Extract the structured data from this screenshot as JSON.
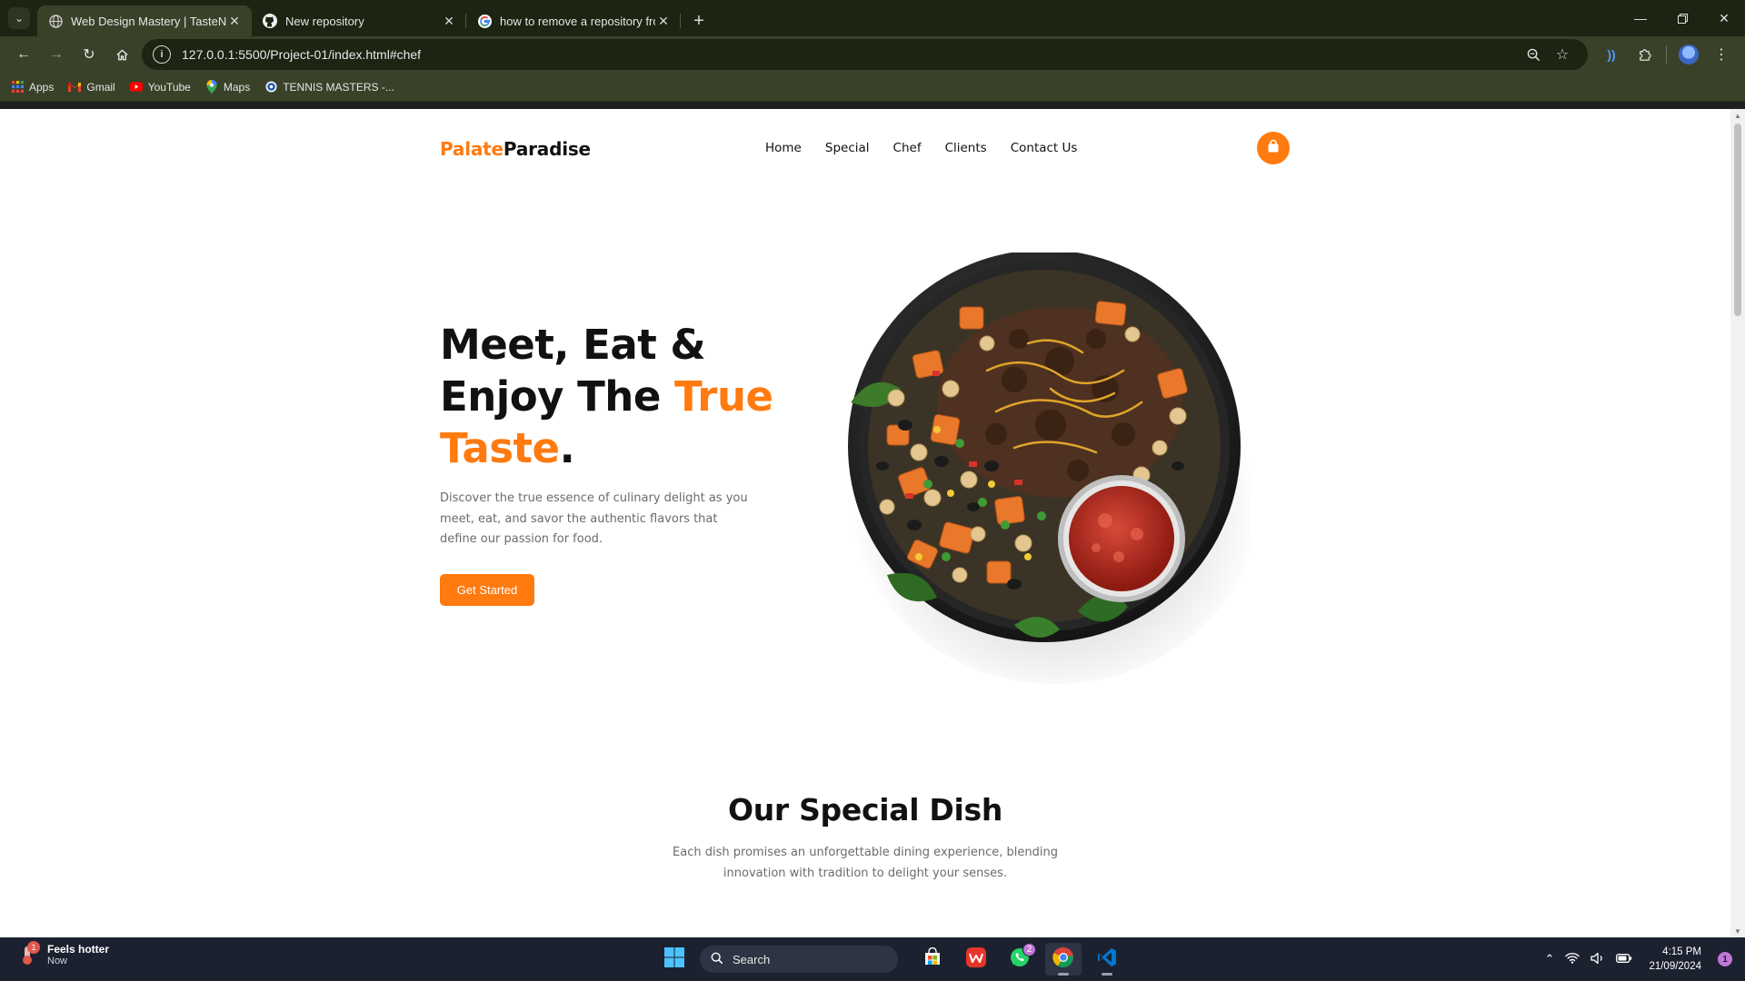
{
  "browser": {
    "tabs": [
      {
        "title": "Web Design Mastery | TasteNest",
        "icon": "globe-icon",
        "active": true
      },
      {
        "title": "New repository",
        "icon": "github-icon",
        "active": false
      },
      {
        "title": "how to remove a repository from",
        "icon": "google-icon",
        "active": false
      }
    ],
    "url": "127.0.0.1:5500/Project-01/index.html#chef",
    "bookmarks": [
      {
        "label": "Apps",
        "icon": "apps-grid-icon"
      },
      {
        "label": "Gmail",
        "icon": "gmail-icon"
      },
      {
        "label": "YouTube",
        "icon": "youtube-icon"
      },
      {
        "label": "Maps",
        "icon": "maps-icon"
      },
      {
        "label": "TENNIS MASTERS -...",
        "icon": "tennis-icon"
      }
    ]
  },
  "site": {
    "logo": {
      "accent": "Palate",
      "rest": "Paradise"
    },
    "nav": [
      "Home",
      "Special",
      "Chef",
      "Clients",
      "Contact Us"
    ],
    "hero": {
      "line1": "Meet, Eat &",
      "line2a": "Enjoy The ",
      "line2b": "True",
      "line3a": "Taste",
      "line3b": ".",
      "description": "Discover the true essence of culinary delight as you meet, eat, and savor the authentic flavors that define our passion for food.",
      "cta": "Get Started"
    },
    "special": {
      "title": "Our Special Dish",
      "description": "Each dish promises an unforgettable dining experience, blending innovation with tradition to delight your senses."
    },
    "colors": {
      "accent": "#ff7a0f",
      "text": "#111111",
      "muted": "#6b6b6b"
    }
  },
  "taskbar": {
    "weather": {
      "title": "Feels hotter",
      "subtitle": "Now",
      "badge": "1"
    },
    "search_placeholder": "Search",
    "whatsapp_badge": "2",
    "time": "4:15 PM",
    "date": "21/09/2024",
    "notification_count": "1"
  }
}
